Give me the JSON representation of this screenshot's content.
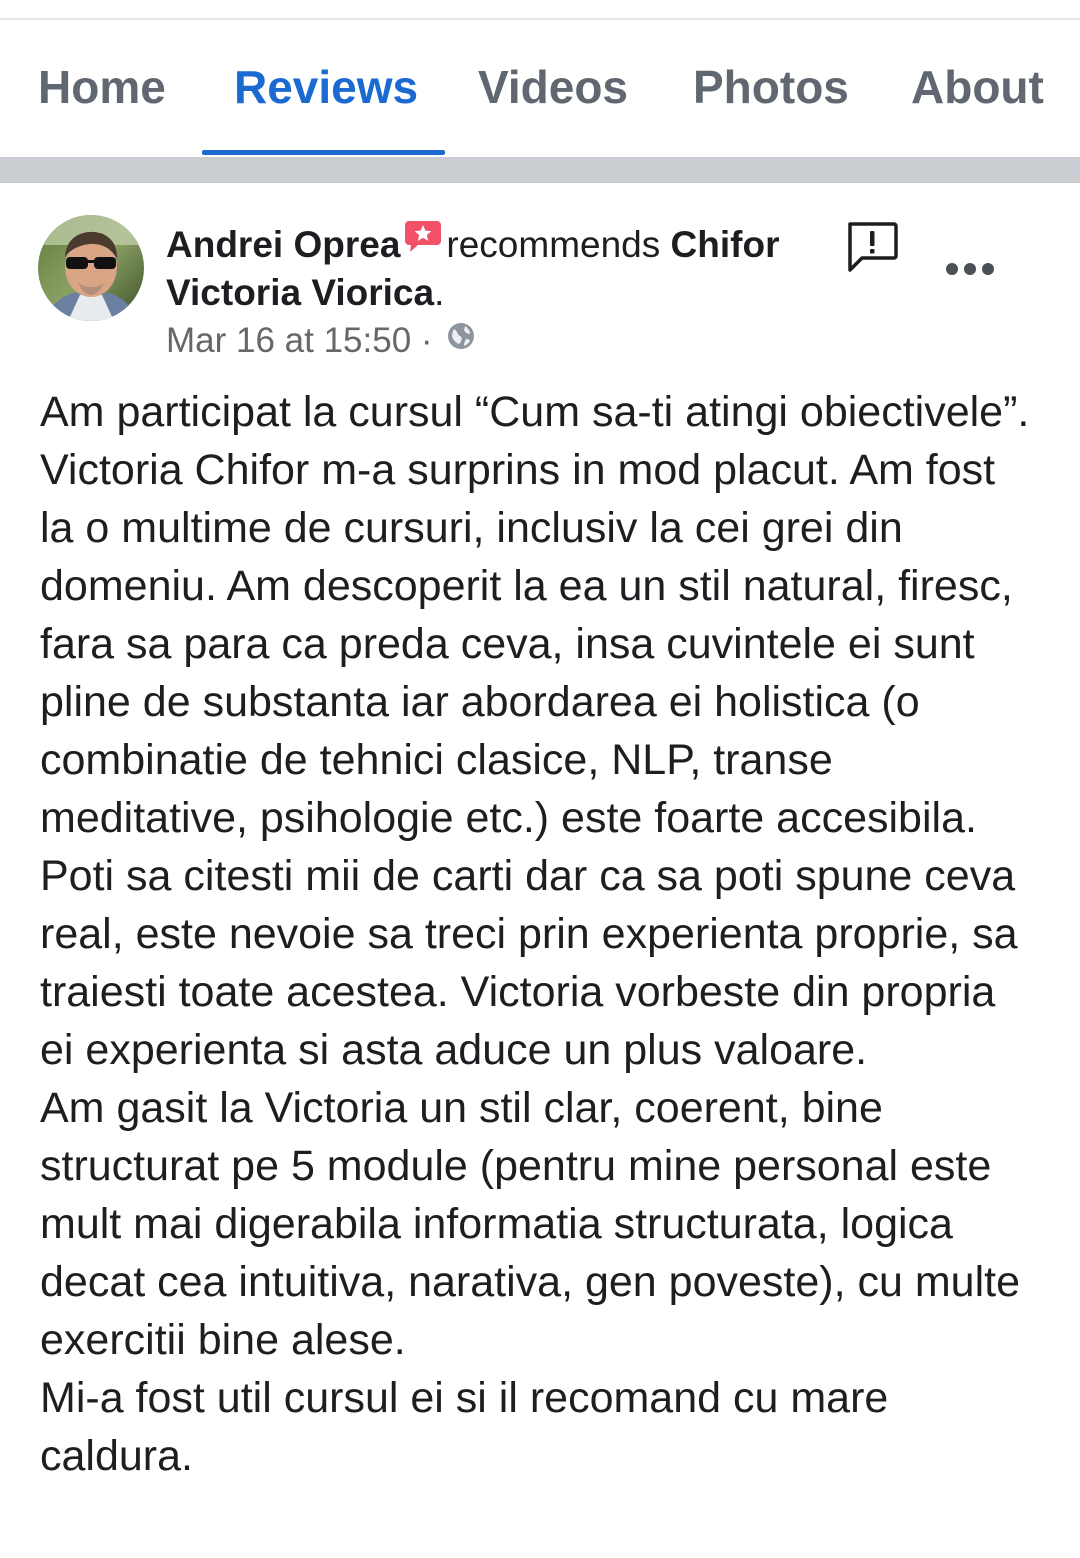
{
  "tabs": [
    {
      "label": "Home",
      "active": false
    },
    {
      "label": "Reviews",
      "active": true
    },
    {
      "label": "Videos",
      "active": false
    },
    {
      "label": "Photos",
      "active": false
    },
    {
      "label": "About",
      "active": false
    }
  ],
  "colors": {
    "accent": "#1b6ad2",
    "recommend_badge": "#f25268",
    "muted_text": "#65676b",
    "divider": "#c9ccd1"
  },
  "review": {
    "author": "Andrei Oprea",
    "badge_icon": "recommend-badge-icon",
    "verb": "recommends",
    "page_name_part1": "Chifor",
    "page_name_part2": "Victoria Viorica",
    "page_name_end": ".",
    "date": "Mar 16 at 15:50",
    "separator": "·",
    "privacy_icon": "globe-icon",
    "report_icon": "report-icon",
    "more_icon": "more-options-icon",
    "paragraphs": [
      "Am participat la cursul “Cum sa-ti atingi obiectivele”. Victoria Chifor m-a surprins in mod placut. Am fost la o multime de cursuri, inclusiv la cei grei din domeniu. Am descoperit la ea un stil natural, firesc, fara sa para ca preda ceva, insa cuvintele ei sunt pline de substanta iar abordarea ei holistica (o combinatie de tehnici clasice, NLP, transe meditative, psihologie etc.) este foarte accesibila. Poti sa citesti mii de carti dar ca sa poti spune ceva real, este nevoie sa treci prin experienta proprie, sa traiesti toate acestea. Victoria vorbeste din propria ei experienta si asta aduce un plus valoare.",
      "Am gasit la Victoria un stil clar, coerent, bine structurat pe 5 module (pentru mine personal este mult mai digerabila informatia structurata, logica decat cea intuitiva, narativa, gen poveste), cu multe exercitii bine alese.",
      "Mi-a fost util cursul ei si il recomand cu mare caldura."
    ]
  }
}
